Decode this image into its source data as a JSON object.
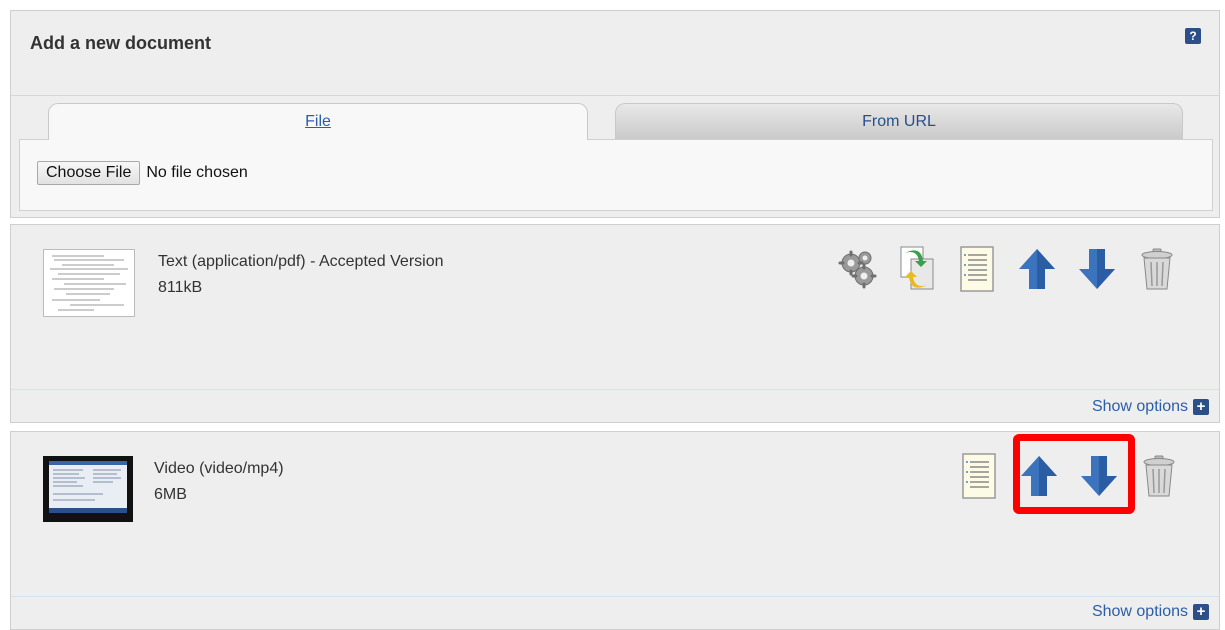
{
  "add_panel": {
    "title": "Add a new document",
    "help_icon": "question-icon",
    "help_glyph": "?",
    "tabs": [
      {
        "label": "File",
        "active": true
      },
      {
        "label": "From URL",
        "active": false
      }
    ],
    "file_input": {
      "button_label": "Choose File",
      "status": "No file chosen"
    }
  },
  "documents": [
    {
      "title": "Text (application/pdf) - Accepted Version",
      "size": "811kB",
      "thumbnail": "pdf-thumbnail",
      "actions": [
        "gears-icon",
        "convert-icon",
        "document-icon",
        "up-arrow-icon",
        "down-arrow-icon",
        "trash-icon"
      ],
      "show_options": "Show options"
    },
    {
      "title": "Video (video/mp4)",
      "size": "6MB",
      "thumbnail": "video-thumbnail",
      "actions": [
        "document-icon",
        "up-arrow-icon",
        "down-arrow-icon",
        "trash-icon"
      ],
      "show_options": "Show options"
    }
  ],
  "colors": {
    "accent": "#2b5ea8",
    "arrow": "#3b73bd",
    "highlight": "#ff0000",
    "panel_bg": "#eeeeee"
  }
}
